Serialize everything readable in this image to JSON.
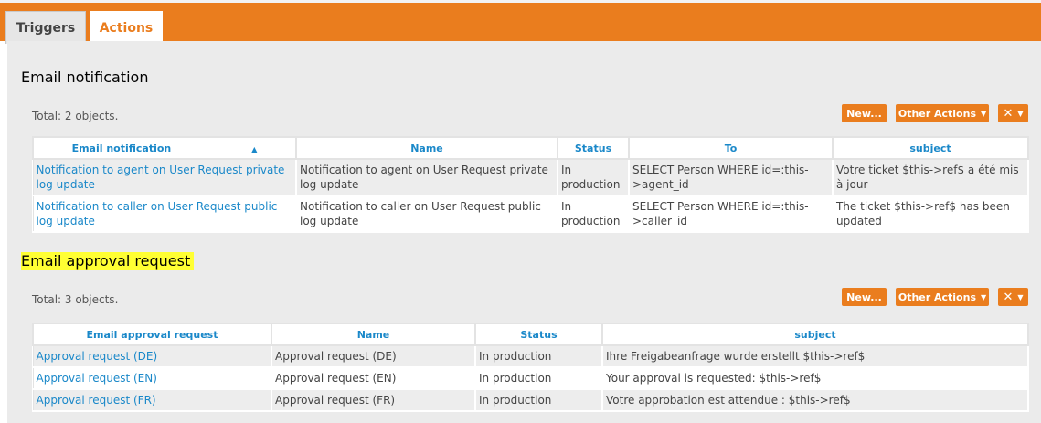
{
  "tabs": [
    {
      "label": "Triggers"
    },
    {
      "label": "Actions"
    }
  ],
  "section1": {
    "title": "Email notification",
    "total": "Total: 2 objects.",
    "buttons": {
      "new": "New...",
      "other": "Other Actions"
    },
    "columns": [
      "Email notification",
      "Name",
      "Status",
      "To",
      "subject"
    ],
    "rows": [
      [
        "Notification to agent on User Request private log update",
        "Notification to agent on User Request private log update",
        "In production",
        "SELECT Person WHERE id=:this->agent_id",
        "Votre ticket $this->ref$ a été mis à jour"
      ],
      [
        "Notification to caller on User Request public log update",
        "Notification to caller on User Request public log update",
        "In production",
        "SELECT Person WHERE id=:this->caller_id",
        "The ticket $this->ref$ has been updated"
      ]
    ]
  },
  "section2": {
    "title": "Email approval request",
    "total": "Total: 3 objects.",
    "buttons": {
      "new": "New...",
      "other": "Other Actions"
    },
    "columns": [
      "Email approval request",
      "Name",
      "Status",
      "subject"
    ],
    "rows": [
      [
        "Approval request (DE)",
        "Approval request (DE)",
        "In production",
        "Ihre Freigabeanfrage wurde erstellt $this->ref$"
      ],
      [
        "Approval request (EN)",
        "Approval request (EN)",
        "In production",
        "Your approval is requested: $this->ref$"
      ],
      [
        "Approval request (FR)",
        "Approval request (FR)",
        "In production",
        "Votre approbation est attendue : $this->ref$"
      ]
    ]
  },
  "colors": {
    "accent": "#ea7d1e",
    "link": "#1a88c9",
    "highlight": "#ffff33"
  }
}
